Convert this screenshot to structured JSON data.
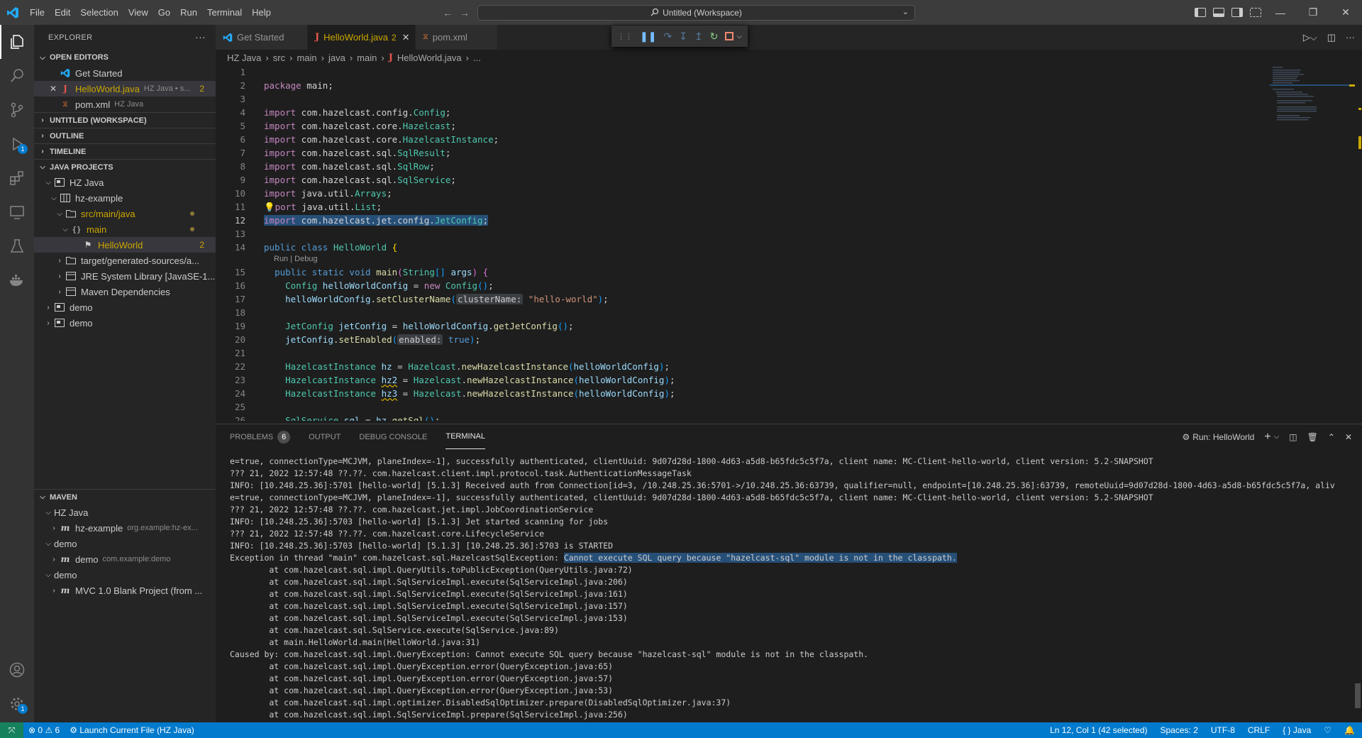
{
  "menu": [
    "File",
    "Edit",
    "Selection",
    "View",
    "Go",
    "Run",
    "Terminal",
    "Help"
  ],
  "command_center": "Untitled (Workspace)",
  "sidebar": {
    "title": "EXPLORER",
    "open_editors": {
      "header": "OPEN EDITORS",
      "items": [
        {
          "label": "Get Started",
          "desc": "",
          "count": ""
        },
        {
          "label": "HelloWorld.java",
          "desc": "HZ Java • s...",
          "count": "2"
        },
        {
          "label": "pom.xml",
          "desc": "HZ Java",
          "count": ""
        }
      ]
    },
    "sections": [
      "UNTITLED (WORKSPACE)",
      "OUTLINE",
      "TIMELINE",
      "JAVA PROJECTS"
    ],
    "java_projects": [
      {
        "label": "HZ Java"
      },
      {
        "label": "hz-example"
      },
      {
        "label": "src/main/java"
      },
      {
        "label": "main"
      },
      {
        "label": "HelloWorld",
        "count": "2"
      },
      {
        "label": "target/generated-sources/a..."
      },
      {
        "label": "JRE System Library [JavaSE-1..."
      },
      {
        "label": "Maven Dependencies"
      },
      {
        "label": "demo"
      },
      {
        "label": "demo"
      }
    ],
    "maven": {
      "header": "MAVEN",
      "items": [
        {
          "label": "HZ Java",
          "desc": ""
        },
        {
          "label": "hz-example",
          "desc": "org.example:hz-ex..."
        },
        {
          "label": "demo",
          "desc": ""
        },
        {
          "label": "demo",
          "desc": "com.example:demo"
        },
        {
          "label": "demo",
          "desc": ""
        },
        {
          "label": "MVC 1.0 Blank Project (from ...",
          "desc": ""
        }
      ]
    }
  },
  "tabs": [
    {
      "label": "Get Started",
      "count": ""
    },
    {
      "label": "HelloWorld.java",
      "count": "2"
    },
    {
      "label": "pom.xml",
      "count": ""
    }
  ],
  "breadcrumb": [
    "HZ Java",
    "src",
    "main",
    "java",
    "main",
    "HelloWorld.java",
    "..."
  ],
  "code": {
    "line_numbers": [
      "1",
      "2",
      "3",
      "4",
      "5",
      "6",
      "7",
      "8",
      "9",
      "10",
      "11",
      "12",
      "13",
      "14",
      "15",
      "16",
      "17",
      "18",
      "19",
      "20",
      "21",
      "22",
      "23",
      "24",
      "25",
      "26"
    ],
    "codelens": "Run | Debug",
    "current_line": "12"
  },
  "panel": {
    "tabs": [
      "PROBLEMS",
      "OUTPUT",
      "DEBUG CONSOLE",
      "TERMINAL"
    ],
    "problems_count": "6",
    "terminal_name": "Run: HelloWorld",
    "lines": [
      "e=true, connectionType=MCJVM, planeIndex=-1], successfully authenticated, clientUuid: 9d07d28d-1800-4d63-a5d8-b65fdc5c5f7a, client name: MC-Client-hello-world, client version: 5.2-SNAPSHOT",
      "??? 21, 2022 12:57:48 ??.??. com.hazelcast.client.impl.protocol.task.AuthenticationMessageTask",
      "INFO: [10.248.25.36]:5701 [hello-world] [5.1.3] Received auth from Connection[id=3, /10.248.25.36:5701->/10.248.25.36:63739, qualifier=null, endpoint=[10.248.25.36]:63739, remoteUuid=9d07d28d-1800-4d63-a5d8-b65fdc5c5f7a, aliv",
      "e=true, connectionType=MCJVM, planeIndex=-1], successfully authenticated, clientUuid: 9d07d28d-1800-4d63-a5d8-b65fdc5c5f7a, client name: MC-Client-hello-world, client version: 5.2-SNAPSHOT",
      "??? 21, 2022 12:57:48 ??.??. com.hazelcast.jet.impl.JobCoordinationService",
      "INFO: [10.248.25.36]:5703 [hello-world] [5.1.3] Jet started scanning for jobs",
      "??? 21, 2022 12:57:48 ??.??. com.hazelcast.core.LifecycleService",
      "INFO: [10.248.25.36]:5703 [hello-world] [5.1.3] [10.248.25.36]:5703 is STARTED",
      "Exception in thread \"main\" com.hazelcast.sql.HazelcastSqlException: ",
      "        at com.hazelcast.sql.impl.QueryUtils.toPublicException(QueryUtils.java:72)",
      "        at com.hazelcast.sql.impl.SqlServiceImpl.execute(SqlServiceImpl.java:206)",
      "        at com.hazelcast.sql.impl.SqlServiceImpl.execute(SqlServiceImpl.java:161)",
      "        at com.hazelcast.sql.impl.SqlServiceImpl.execute(SqlServiceImpl.java:157)",
      "        at com.hazelcast.sql.impl.SqlServiceImpl.execute(SqlServiceImpl.java:153)",
      "        at com.hazelcast.sql.SqlService.execute(SqlService.java:89)",
      "        at main.HelloWorld.main(HelloWorld.java:31)",
      "Caused by: com.hazelcast.sql.impl.QueryException: Cannot execute SQL query because \"hazelcast-sql\" module is not in the classpath.",
      "        at com.hazelcast.sql.impl.QueryException.error(QueryException.java:65)",
      "        at com.hazelcast.sql.impl.QueryException.error(QueryException.java:57)",
      "        at com.hazelcast.sql.impl.QueryException.error(QueryException.java:53)",
      "        at com.hazelcast.sql.impl.optimizer.DisabledSqlOptimizer.prepare(DisabledSqlOptimizer.java:37)",
      "        at com.hazelcast.sql.impl.SqlServiceImpl.prepare(SqlServiceImpl.java:256)"
    ],
    "selected_text": "Cannot execute SQL query because \"hazelcast-sql\" module is not in the classpath."
  },
  "statusbar": {
    "errors": "0",
    "warnings": "6",
    "launch": "Launch Current File (HZ Java)",
    "position": "Ln 12, Col 1 (42 selected)",
    "spaces": "Spaces: 2",
    "encoding": "UTF-8",
    "eol": "CRLF",
    "language": "Java"
  },
  "colors": {
    "accent": "#007acc",
    "remote": "#16825d",
    "selection": "#264f78"
  }
}
